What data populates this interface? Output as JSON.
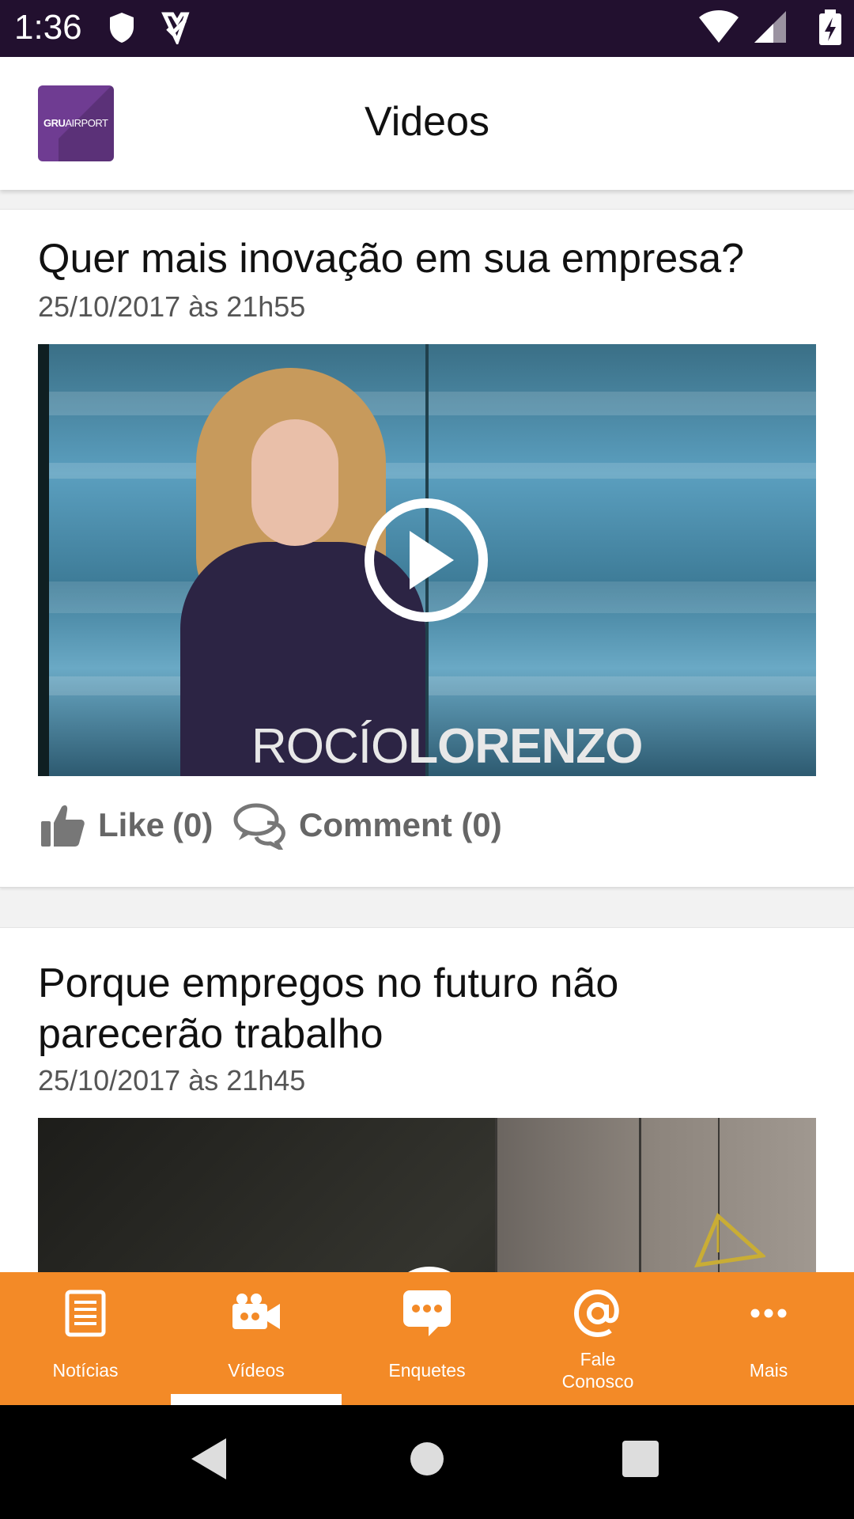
{
  "status_bar": {
    "time": "1:36",
    "icons_left": [
      "shield-icon",
      "task-check-icon"
    ],
    "icons_right": [
      "wifi-icon",
      "signal-icon",
      "battery-charging-icon"
    ]
  },
  "app_bar": {
    "logo_bold": "GRU",
    "logo_light": "AIRPORT",
    "title": "Videos"
  },
  "videos": [
    {
      "title": "Quer mais inovação em sua empresa?",
      "date": "25/10/2017 às 21h55",
      "thumbnail_caption_light": "ROCÍO",
      "thumbnail_caption_bold": "LORENZO",
      "like_label": "Like",
      "like_count": "(0)",
      "comment_label": "Comment (0)"
    },
    {
      "title": "Porque empregos no futuro não parecerão trabalho",
      "date": "25/10/2017 às 21h45"
    }
  ],
  "bottom_nav": {
    "active": "Vídeos",
    "items": [
      {
        "label": "Notícias",
        "icon": "document-icon"
      },
      {
        "label": "Vídeos",
        "icon": "video-camera-icon"
      },
      {
        "label": "Enquetes",
        "icon": "chat-bubble-icon"
      },
      {
        "label": "Fale Conosco",
        "icon": "at-sign-icon"
      },
      {
        "label": "Mais",
        "icon": "more-dots-icon"
      }
    ]
  },
  "colors": {
    "status_bar": "#22102f",
    "brand_purple": "#6f3c92",
    "nav_orange": "#f38a27"
  }
}
